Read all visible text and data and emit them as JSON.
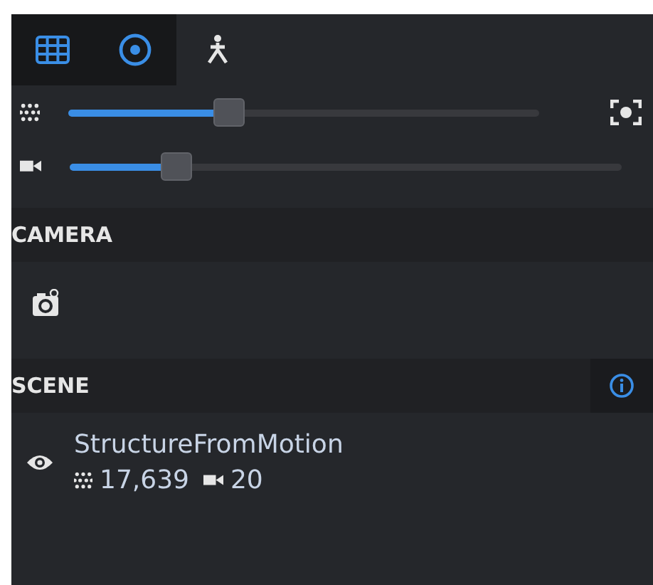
{
  "toolbar": {
    "tabs": [
      {
        "kind": "grid",
        "on": true
      },
      {
        "kind": "target",
        "on": true
      },
      {
        "kind": "merge",
        "on": false
      }
    ]
  },
  "sliders": [
    {
      "kind": "points",
      "level": 0.32
    },
    {
      "kind": "camera",
      "level": 0.18
    }
  ],
  "sections": [
    {
      "kind": "camera",
      "title": "CAMERA",
      "info": false
    },
    {
      "kind": "scene",
      "title": "SCENE",
      "info": true
    }
  ],
  "scene_item": {
    "visible": true,
    "name": "StructureFromMotion",
    "points": "17,639",
    "cameras": "20"
  }
}
